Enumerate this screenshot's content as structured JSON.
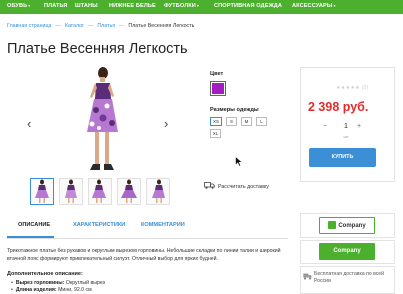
{
  "nav": {
    "items": [
      {
        "label": "ОБУВЬ",
        "has_caret": true
      },
      {
        "label": "ПЛАТЬЯ",
        "has_caret": false
      },
      {
        "label": "ШТАНЫ",
        "has_caret": false
      },
      {
        "label": "НИЖНЕЕ БЕЛЬЕ",
        "has_caret": false
      },
      {
        "label": "ФУТБОЛКИ",
        "has_caret": true
      },
      {
        "label": "СПОРТИВНАЯ ОДЕЖДА",
        "has_caret": false
      },
      {
        "label": "АКСЕССУАРЫ",
        "has_caret": true
      }
    ],
    "caret": "▾"
  },
  "breadcrumb": {
    "items": [
      "Главная страница",
      "Каталог",
      "Платья"
    ],
    "current": "Платье Весенняя Легкость",
    "separator": "—"
  },
  "product": {
    "title": "Платье Весенняя Легкость",
    "color_label": "Цвет",
    "color_value": "#a51cc1",
    "size_label": "Размеры одежды",
    "sizes": [
      "XS",
      "S",
      "M",
      "L",
      "XL"
    ],
    "selected_size": "XS",
    "rating_stars": "★★★★★",
    "rating_count": "(0)",
    "price": "2 398 руб.",
    "qty_minus": "−",
    "qty_value": "1",
    "qty_plus": "+",
    "qty_unit": "шт",
    "buy_label": "КУПИТЬ",
    "delivery_label": "Рассчитать доставку"
  },
  "tabs": {
    "items": [
      "ОПИСАНИЕ",
      "ХАРАКТЕРИСТИКИ",
      "КОММЕНТАРИИ"
    ],
    "active": "ОПИСАНИЕ"
  },
  "description": {
    "text": "Трикотажное платье без рукавов и округлым вырезом горловины. Небольшие складки по линии талии и широкий втачной пояс формируют привлекательный силуэт. Отличный выбор для ярких будней.",
    "subhead": "Дополнительное описание:",
    "bullets": [
      {
        "label": "Вырез горловины:",
        "value": "Округлый вырез"
      },
      {
        "label": "Длина изделия:",
        "value": "Мини, 92.0 см"
      }
    ]
  },
  "sidebar": {
    "brand_badge_1": "Company",
    "brand_badge_2": "Company",
    "shipping_note": "Бесплатная доставка по всей России"
  },
  "colors": {
    "nav_green": "#4caf2e",
    "link_blue": "#3a8fd6",
    "price_red": "#e22b2b",
    "swatch_purple": "#a51cc1"
  }
}
